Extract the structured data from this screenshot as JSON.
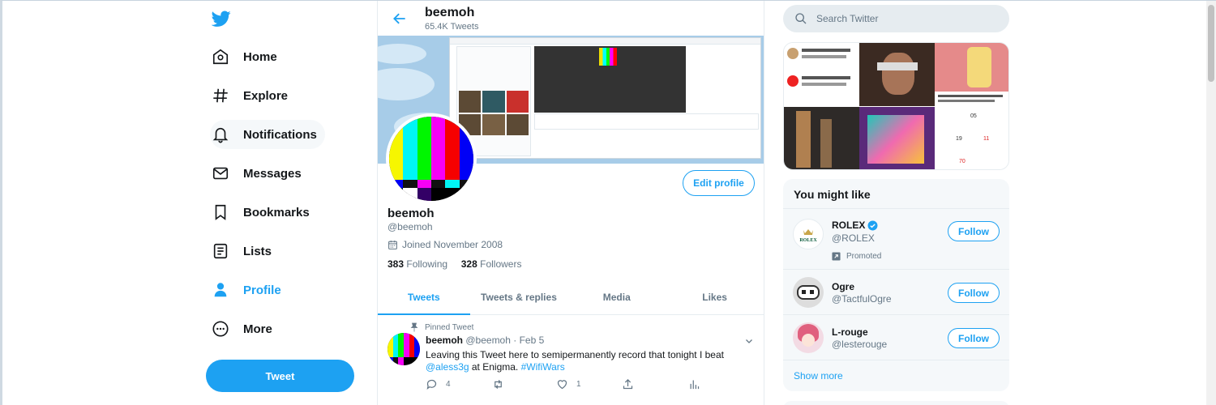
{
  "nav": {
    "items": [
      {
        "label": "Home",
        "icon": "home-icon"
      },
      {
        "label": "Explore",
        "icon": "hashtag-icon"
      },
      {
        "label": "Notifications",
        "icon": "bell-icon"
      },
      {
        "label": "Messages",
        "icon": "envelope-icon"
      },
      {
        "label": "Bookmarks",
        "icon": "bookmark-icon"
      },
      {
        "label": "Lists",
        "icon": "list-icon"
      },
      {
        "label": "Profile",
        "icon": "person-icon"
      },
      {
        "label": "More",
        "icon": "more-circle-icon"
      }
    ],
    "tweet_button": "Tweet",
    "accent": "#1da1f2"
  },
  "header": {
    "name": "beemoh",
    "tweet_count": "65.4K Tweets"
  },
  "profile": {
    "name": "beemoh",
    "handle": "@beemoh",
    "joined": "Joined November 2008",
    "following_count": "383",
    "following_label": "Following",
    "followers_count": "328",
    "followers_label": "Followers",
    "edit_button": "Edit profile"
  },
  "tabs": [
    "Tweets",
    "Tweets & replies",
    "Media",
    "Likes"
  ],
  "tweet": {
    "pinned_label": "Pinned Tweet",
    "author": "beemoh",
    "handle": "@beemoh",
    "separator": "·",
    "date": "Feb 5",
    "text_before": "Leaving this Tweet here to semipermanently record that tonight I beat ",
    "mention": "@aless3g",
    "text_middle": " at Enigma. ",
    "hashtag": "#WifiWars",
    "reply_count": "4",
    "like_count": "1"
  },
  "right": {
    "search_placeholder": "Search Twitter",
    "you_might_like_title": "You might like",
    "suggestions": [
      {
        "name": "ROLEX",
        "handle": "@ROLEX",
        "verified": true,
        "promoted": "Promoted",
        "follow": "Follow"
      },
      {
        "name": "Ogre",
        "handle": "@TactfulOgre",
        "follow": "Follow"
      },
      {
        "name": "L-rouge",
        "handle": "@lesterouge",
        "follow": "Follow"
      }
    ],
    "show_more": "Show more"
  }
}
